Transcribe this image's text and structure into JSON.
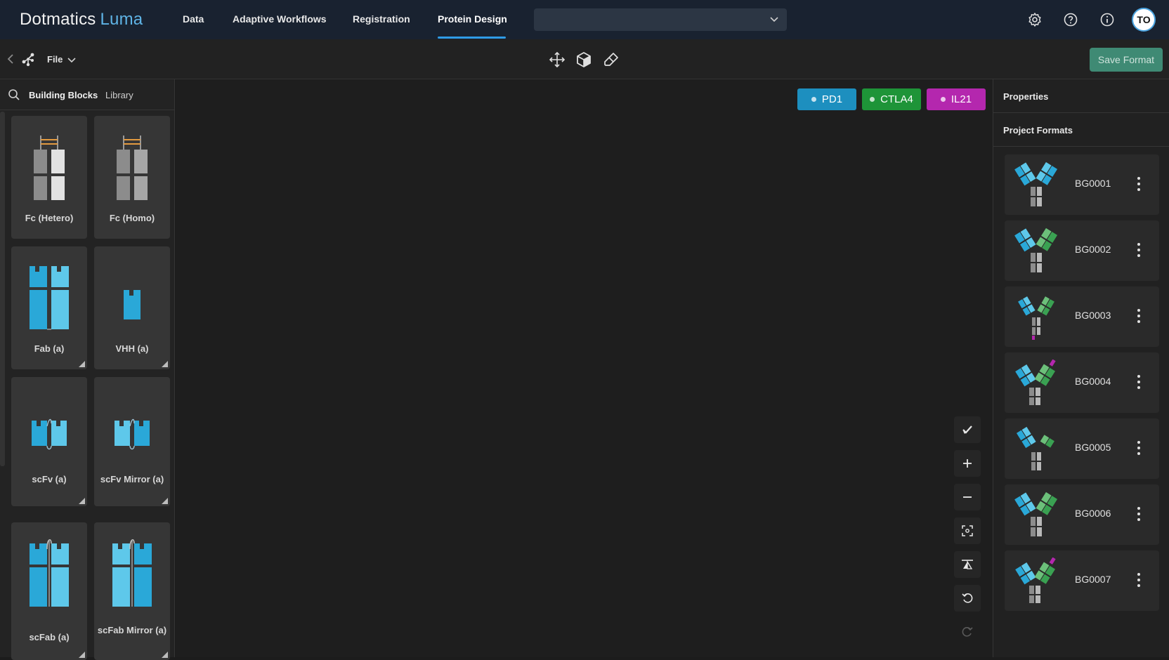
{
  "app": {
    "logo_main": "Dotmatics",
    "logo_sub": "Luma"
  },
  "nav": {
    "items": [
      {
        "label": "Data"
      },
      {
        "label": "Adaptive Workflows"
      },
      {
        "label": "Registration"
      },
      {
        "label": "Protein Design"
      }
    ],
    "active": "Protein Design",
    "select_value": "",
    "user_initials": "TO"
  },
  "toolbar": {
    "file_label": "File",
    "save_label": "Save Format"
  },
  "left_panel": {
    "tabs": [
      {
        "label": "Building Blocks",
        "active": true
      },
      {
        "label": "Library",
        "active": false
      }
    ],
    "blocks": [
      {
        "label": "Fc (Hetero)"
      },
      {
        "label": "Fc (Homo)"
      },
      {
        "label": "Fab (a)"
      },
      {
        "label": "VHH (a)"
      },
      {
        "label": "scFv (a)"
      },
      {
        "label": "scFv Mirror (a)"
      },
      {
        "label": "scFab (a)"
      },
      {
        "label": "scFab Mirror (a)"
      }
    ]
  },
  "canvas": {
    "targets": [
      {
        "label": "PD1",
        "color": "#1d8fbf"
      },
      {
        "label": "CTLA4",
        "color": "#1e9438"
      },
      {
        "label": "IL21",
        "color": "#b427ae"
      }
    ]
  },
  "right_panel": {
    "properties_title": "Properties",
    "formats_title": "Project Formats",
    "formats": [
      {
        "name": "BG0001"
      },
      {
        "name": "BG0002"
      },
      {
        "name": "BG0003"
      },
      {
        "name": "BG0004"
      },
      {
        "name": "BG0005"
      },
      {
        "name": "BG0006"
      },
      {
        "name": "BG0007"
      }
    ]
  },
  "colors": {
    "accent": "#2f9be6",
    "save": "#3f8a74",
    "fab_blue": "#2aa8d8",
    "fab_light": "#5ec8ea",
    "fc_gray": "#8a8a8a",
    "green": "#3aa152",
    "purple": "#b427ae"
  }
}
